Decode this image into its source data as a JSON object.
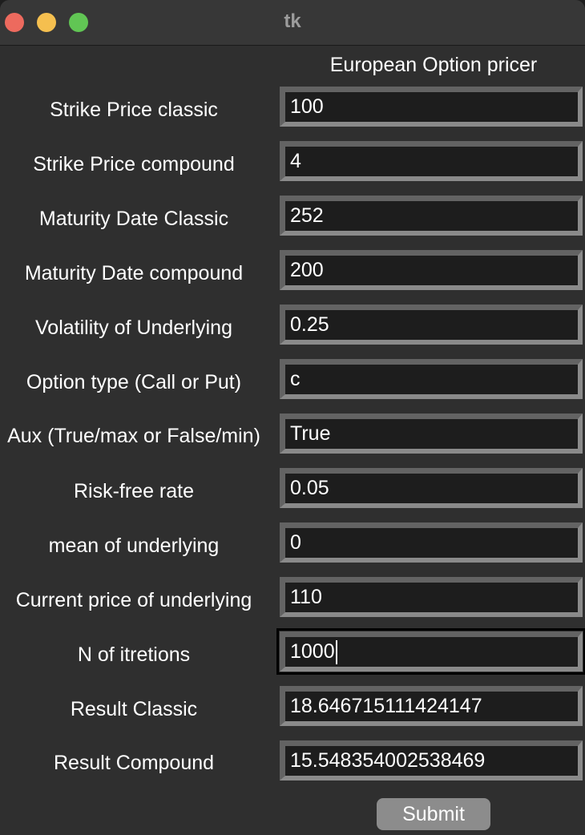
{
  "window": {
    "title": "tk"
  },
  "form": {
    "heading": "European Option pricer",
    "fields": [
      {
        "label": "Strike Price classic",
        "value": "100"
      },
      {
        "label": "Strike Price compound",
        "value": "4"
      },
      {
        "label": "Maturity Date Classic",
        "value": "252"
      },
      {
        "label": "Maturity Date compound",
        "value": "200"
      },
      {
        "label": "Volatility of Underlying",
        "value": "0.25"
      },
      {
        "label": "Option type (Call or Put)",
        "value": "c"
      },
      {
        "label": "Aux (True/max or False/min)",
        "value": "True"
      },
      {
        "label": "Risk-free rate",
        "value": "0.05"
      },
      {
        "label": "mean of underlying",
        "value": "0"
      },
      {
        "label": "Current price of underlying",
        "value": "110"
      },
      {
        "label": "N of itretions",
        "value": "1000"
      },
      {
        "label": "Result Classic",
        "value": "18.646715111424147"
      },
      {
        "label": "Result Compound",
        "value": "15.548354002538469"
      }
    ],
    "submit_label": "Submit"
  },
  "colors": {
    "background": "#2f2f2f",
    "field_bg": "#1d1d1d",
    "button_bg": "#8c8c8c",
    "close": "#ed6a5e",
    "minimize": "#f5bf4f",
    "maximize": "#61c554"
  }
}
